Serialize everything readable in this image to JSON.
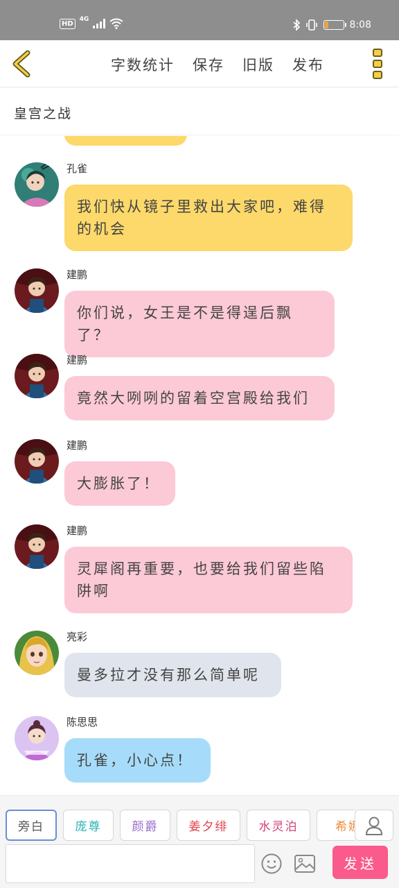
{
  "status_bar": {
    "hd": "HD",
    "network": "4G",
    "time": "8:08",
    "battery_level": 0.2,
    "battery_color": "#f2a33a"
  },
  "toolbar": {
    "back_icon": "chevron-left-icon",
    "word_count": "字数统计",
    "save": "保存",
    "old_version": "旧版",
    "publish": "发布",
    "more_icon": "more-vertical-icon"
  },
  "chat": {
    "title": "皇宫之战",
    "messages": [
      {
        "sender": "孔雀",
        "text": "我们快从镜子里救出大家吧，难得的机会",
        "color": "yellow",
        "avatar": "avatar-kongque"
      },
      {
        "sender": "建鹏",
        "text": "你们说，女王是不是得逞后飘了？",
        "color": "pink",
        "avatar": "avatar-jianpeng"
      },
      {
        "sender": "建鹏",
        "text": "竟然大咧咧的留着空宫殿给我们",
        "color": "pink",
        "avatar": "avatar-jianpeng"
      },
      {
        "sender": "建鹏",
        "text": "大膨胀了！",
        "color": "pink",
        "avatar": "avatar-jianpeng"
      },
      {
        "sender": "建鹏",
        "text": "灵犀阁再重要，也要给我们留些陷阱啊",
        "color": "pink",
        "avatar": "avatar-jianpeng"
      },
      {
        "sender": "亮彩",
        "text": "曼多拉才没有那么简单呢",
        "color": "gray",
        "avatar": "avatar-liangcai"
      },
      {
        "sender": "陈思思",
        "text": "孔雀，小心点！",
        "color": "blue",
        "avatar": "avatar-chensisi"
      }
    ]
  },
  "roles": [
    {
      "label": "旁白",
      "color": "#555555"
    },
    {
      "label": "庞尊",
      "color": "#2bb3b3"
    },
    {
      "label": "颜爵",
      "color": "#9a6ad0"
    },
    {
      "label": "姜夕绯",
      "color": "#e0404a"
    },
    {
      "label": "水灵泊",
      "color": "#d0407a"
    },
    {
      "label": "希娜",
      "color": "#f08a3a"
    }
  ],
  "input": {
    "placeholder": "",
    "send": "发送"
  },
  "colors": {
    "yellow": "#fcd96a",
    "pink": "#fcc9d6",
    "gray": "#e0e4ec",
    "blue": "#a6dcfa",
    "send": "#fb5a8c"
  }
}
